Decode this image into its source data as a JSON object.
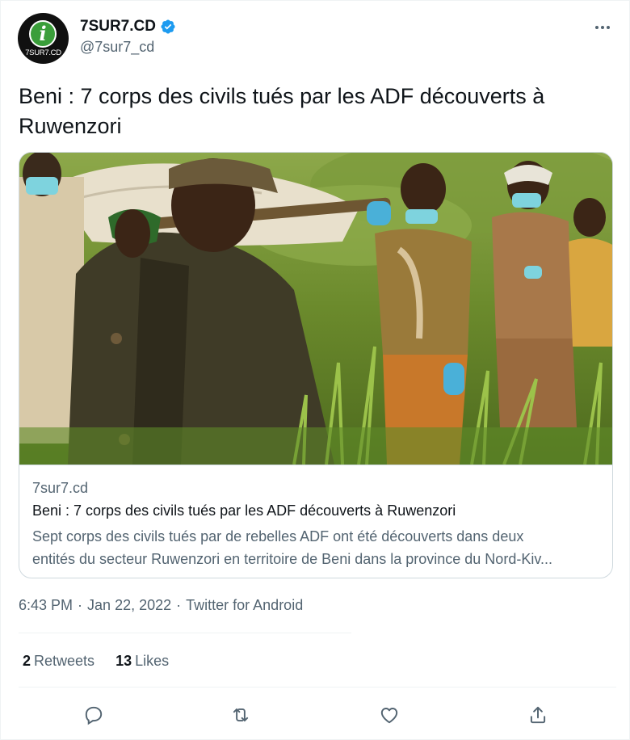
{
  "author": {
    "display_name": "7SUR7.CD",
    "handle": "@7sur7_cd",
    "avatar_text": "7SUR7.CD",
    "avatar_letter": "i",
    "verified_icon": "verified-badge-icon"
  },
  "tweet": {
    "text": "Beni : 7 corps des civils tués par les ADF découverts à Ruwenzori"
  },
  "card": {
    "domain": "7sur7.cd",
    "title": "Beni : 7 corps des civils tués par les ADF découverts à Ruwenzori",
    "description_line1": "Sept corps des civils tués par de rebelles ADF ont été découverts dans deux",
    "description_line2": "entités du secteur Ruwenzori en territoire de Beni dans la province du Nord-Kiv..."
  },
  "meta": {
    "time": "6:43 PM",
    "sep1": "·",
    "date": "Jan 22, 2022",
    "sep2": "·",
    "source": "Twitter for Android"
  },
  "stats": {
    "retweets_count": "2",
    "retweets_label": "Retweets",
    "likes_count": "13",
    "likes_label": "Likes"
  },
  "actions": {
    "reply": "reply-icon",
    "retweet": "retweet-icon",
    "like": "heart-icon",
    "share": "share-icon"
  },
  "colors": {
    "text_primary": "#0f1419",
    "text_secondary": "#536471",
    "verified_blue": "#1d9bf0",
    "border": "#cfd9de"
  }
}
